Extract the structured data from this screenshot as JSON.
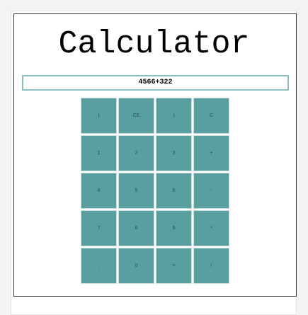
{
  "title": "Calculator",
  "display": {
    "value": "4566+322"
  },
  "colors": {
    "button": "#5a9fa0",
    "display_border": "#8dc0c0"
  },
  "keys": [
    "(",
    "CE",
    ")",
    "C",
    "1",
    "2",
    "3",
    "+",
    "4",
    "5",
    "6",
    "-",
    "7",
    "8",
    "9",
    "*",
    ".",
    "0",
    "=",
    "/"
  ]
}
